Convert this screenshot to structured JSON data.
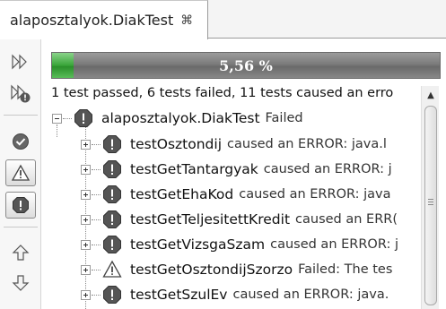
{
  "tab": {
    "title": "alaposztalyok.DiakTest",
    "close_glyph": "⌘"
  },
  "toolbar": {
    "buttons": [
      {
        "name": "rerun-icon",
        "pressed": false
      },
      {
        "name": "rerun-failed-icon",
        "pressed": false
      },
      {
        "name": "show-passed-icon",
        "pressed": false
      },
      {
        "name": "show-failures-icon",
        "pressed": true
      },
      {
        "name": "show-errors-icon",
        "pressed": true
      },
      {
        "name": "previous-failure-icon",
        "pressed": false
      },
      {
        "name": "next-failure-icon",
        "pressed": false
      }
    ]
  },
  "progress": {
    "label": "5,56 %",
    "percent": 5.56
  },
  "summary": "1 test passed, 6 tests failed, 11 tests caused an erro",
  "tree": {
    "root": {
      "name": "alaposztalyok.DiakTest",
      "status": "Failed",
      "icon": "error-icon"
    },
    "children": [
      {
        "name": "testOsztondij",
        "status": "caused an ERROR: java.l",
        "icon": "error-icon"
      },
      {
        "name": "testGetTantargyak",
        "status": "caused an ERROR: j",
        "icon": "error-icon"
      },
      {
        "name": "testGetEhaKod",
        "status": "caused an ERROR: java",
        "icon": "error-icon"
      },
      {
        "name": "testGetTeljesitettKredit",
        "status": "caused an ERR(",
        "icon": "error-icon"
      },
      {
        "name": "testGetVizsgaSzam",
        "status": "caused an ERROR: j",
        "icon": "error-icon"
      },
      {
        "name": "testGetOsztondijSzorzo",
        "status": "Failed: The tes",
        "icon": "warning-icon"
      },
      {
        "name": "testGetSzulEv",
        "status": "caused an ERROR: java.",
        "icon": "error-icon"
      }
    ]
  },
  "colors": {
    "progress_fill": "#3aa53a",
    "progress_track": "#7b7b7b",
    "error": "#555555",
    "warning": "#e8c820"
  }
}
